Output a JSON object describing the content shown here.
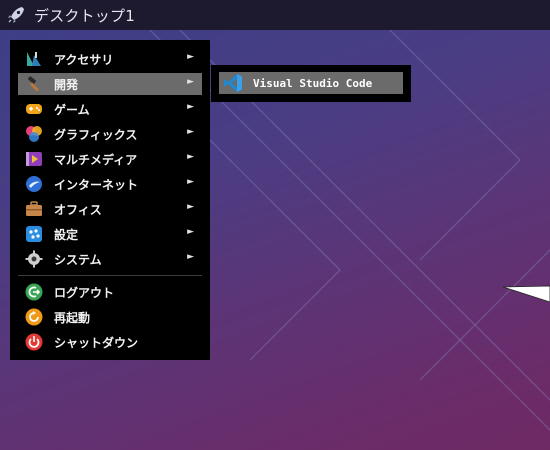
{
  "taskbar": {
    "title": "デスクトップ1",
    "icon": "rocket-icon"
  },
  "menu": {
    "categories": [
      {
        "label": "アクセサリ",
        "icon": "accessories-icon",
        "has_submenu": true
      },
      {
        "label": "開発",
        "icon": "hammer-icon",
        "has_submenu": true,
        "active": true
      },
      {
        "label": "ゲーム",
        "icon": "gamepad-icon",
        "has_submenu": true
      },
      {
        "label": "グラフィックス",
        "icon": "graphics-icon",
        "has_submenu": true
      },
      {
        "label": "マルチメディア",
        "icon": "multimedia-icon",
        "has_submenu": true
      },
      {
        "label": "インターネット",
        "icon": "internet-icon",
        "has_submenu": true
      },
      {
        "label": "オフィス",
        "icon": "briefcase-icon",
        "has_submenu": true
      },
      {
        "label": "設定",
        "icon": "settings-icon",
        "has_submenu": true
      },
      {
        "label": "システム",
        "icon": "gear-icon",
        "has_submenu": true
      }
    ],
    "actions": [
      {
        "label": "ログアウト",
        "icon": "logout-icon"
      },
      {
        "label": "再起動",
        "icon": "restart-icon"
      },
      {
        "label": "シャットダウン",
        "icon": "power-icon"
      }
    ],
    "arrow": "►"
  },
  "submenu": {
    "items": [
      {
        "label": "Visual Studio Code",
        "icon": "vscode-icon"
      }
    ]
  },
  "colors": {
    "menu_bg": "#000000",
    "highlight": "#6b6b6b",
    "topbar": "#1d1a30"
  }
}
